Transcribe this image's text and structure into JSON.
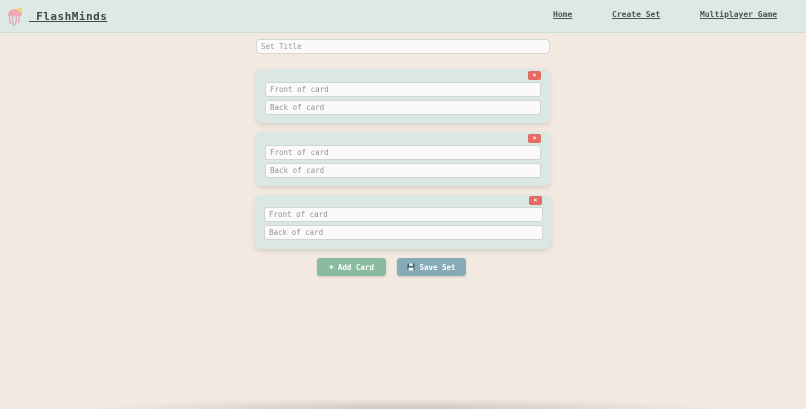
{
  "header": {
    "brand": " FlashMinds",
    "logo_icon": "jellyfish-icon",
    "nav": [
      {
        "label": "Home"
      },
      {
        "label": "Create Set"
      },
      {
        "label": "Multiplayer Game"
      }
    ]
  },
  "form": {
    "title_placeholder": "Set Title",
    "title_value": "",
    "cards": [
      {
        "front_placeholder": "Front of card",
        "back_placeholder": "Back of card",
        "delete_label": "×"
      },
      {
        "front_placeholder": "Front of card",
        "back_placeholder": "Back of card",
        "delete_label": "×"
      },
      {
        "front_placeholder": "Front of card",
        "back_placeholder": "Back of card",
        "delete_label": "×"
      }
    ],
    "add_card_label": "Add Card",
    "add_card_icon": "plus-icon",
    "save_set_label": "Save Set",
    "save_set_icon": "floppy-disk-icon"
  },
  "colors": {
    "background": "#f2e9e0",
    "header": "#dde9e5",
    "card": "#dbe7e3",
    "delete": "#e46a63",
    "add": "#89bba0",
    "save": "#86aab8"
  }
}
